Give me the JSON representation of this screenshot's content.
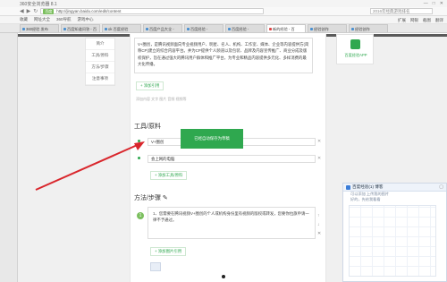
{
  "browser": {
    "title": "360安全浏览器 8.1",
    "address_tag": "百度",
    "url": "http://jingyan.baidu.com/edit/content",
    "search_placeholder": "2016年经典游戏排名",
    "window_controls": [
      "—",
      "□",
      "✕"
    ],
    "bookmarks": [
      "收藏",
      "网址大全",
      "360导航",
      "游戏中心"
    ],
    "bookmarks_right": [
      "扩展",
      "网银",
      "截图",
      "翻译"
    ],
    "tabs": [
      {
        "label": "360经验 发布"
      },
      {
        "label": "百度知道问答 - 百"
      },
      {
        "label": "ok 百度经验"
      },
      {
        "label": "百度产品大全 -"
      },
      {
        "label": "百度经验 - "
      },
      {
        "label": "百度经验 - "
      },
      {
        "label": "新的经验 - 百"
      },
      {
        "label": "经验创作"
      },
      {
        "label": "经验创作"
      },
      {
        "label": "上传 - 百度"
      }
    ]
  },
  "leftnav": [
    "简介",
    "工具/原料",
    "方法/步骤",
    "注意事项"
  ],
  "intro": {
    "text": "V+圈创，是腾讯视频面向专业视频用户、明星、名人、机构、工作室、媒体、企业等内容提供方(简称CP)建立的综合内容平台。并为CP提供个人频道以及包装、品牌及内容宣传推广、商业分成及版权保护，旨在通过强大的腾讯用户群体和推广平台，为专业和精品内容提供多元化、多样消费的最大化传播。",
    "add_link": "+ 添加引用",
    "note": "添加内容  文字  图片  音频  视频等"
  },
  "tools": {
    "title": "工具/原料",
    "items": [
      "V+圈创",
      "会上网的电脑"
    ],
    "add": "+ 添加工具/原料"
  },
  "callout": "已经自动保存为草稿",
  "steps": {
    "title": "方法/步骤",
    "number": "1",
    "text": "1、您需要在腾讯视频V+圈创的个人或机构身份里有视频的版权或转发，您要你拉旗申请一律不予通过。",
    "add": "+ 添加图片引用"
  },
  "right_panel": {
    "label": "百度经验APP"
  },
  "chat": {
    "title": "百度经验(1) 博客",
    "lines": [
      "可以添加   上传我的图片",
      "好的，先给我看看"
    ]
  }
}
